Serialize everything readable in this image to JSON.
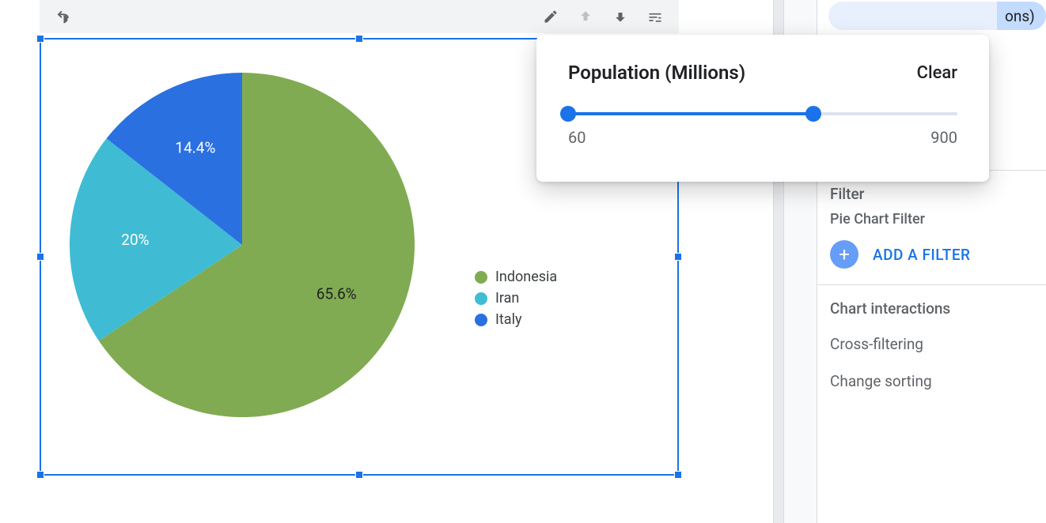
{
  "chart_data": {
    "type": "pie",
    "series": [
      {
        "name": "Indonesia",
        "value": 65.6,
        "color": "#80ab52",
        "label": "65.6%"
      },
      {
        "name": "Iran",
        "value": 20.0,
        "color": "#3fbcd3",
        "label": "20%"
      },
      {
        "name": "Italy",
        "value": 14.4,
        "color": "#2a70e0",
        "label": "14.4%"
      }
    ]
  },
  "popover": {
    "title": "Population (Millions)",
    "clear": "Clear",
    "min_label": "60",
    "max_label": "900",
    "fill_pct": 63
  },
  "sidebar": {
    "chip_suffix": "ons)",
    "filter_title": "Filter",
    "filter_sub": "Pie Chart Filter",
    "add_filter": "ADD A FILTER",
    "interactions_title": "Chart interactions",
    "opt_cross": "Cross-filtering",
    "opt_sort": "Change sorting"
  }
}
